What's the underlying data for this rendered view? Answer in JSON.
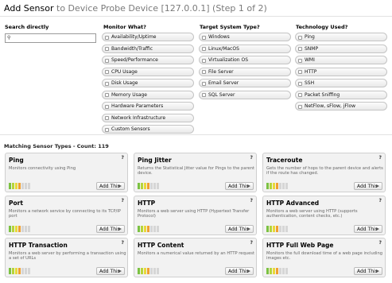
{
  "header": {
    "title": "Add Sensor",
    "subtitle": "to Device Probe Device [127.0.0.1] (Step 1 of 2)"
  },
  "search": {
    "heading": "Search directly",
    "value": "",
    "placeholder": ""
  },
  "monitor": {
    "heading": "Monitor What?",
    "items": [
      "Availability/Uptime",
      "Bandwidth/Traffic",
      "Speed/Performance",
      "CPU Usage",
      "Disk Usage",
      "Memory Usage",
      "Hardware Parameters",
      "Network Infrastructure",
      "Custom Sensors"
    ]
  },
  "target": {
    "heading": "Target System Type?",
    "items": [
      "Windows",
      "Linux/MacOS",
      "Virtualization OS",
      "File Server",
      "Email Server",
      "SQL Server"
    ]
  },
  "technology": {
    "heading": "Technology Used?",
    "items": [
      "Ping",
      "SNMP",
      "WMI",
      "HTTP",
      "SSH",
      "Packet Sniffing",
      "NetFlow, sFlow, jFlow"
    ]
  },
  "results": {
    "count_label": "Matching Sensor Types - Count: 119",
    "add_label": "Add This",
    "help_label": "?",
    "cards": [
      {
        "name": "Ping",
        "desc": "Monitors connectivity using Ping",
        "level": 4
      },
      {
        "name": "Ping Jitter",
        "desc": "Returns the Statistical Jitter value for Pings to the parent device.",
        "level": 4
      },
      {
        "name": "Traceroute",
        "desc": "Gets the number of hops to the parent device and alerts if the route has changed.",
        "level": 4
      },
      {
        "name": "Port",
        "desc": "Monitors a network service by connecting to its TCP/IP port",
        "level": 4
      },
      {
        "name": "HTTP",
        "desc": "Monitors a web server using HTTP (Hypertext Transfer Protocol)",
        "level": 4
      },
      {
        "name": "HTTP Advanced",
        "desc": "Monitors a web server using HTTP (supports authentication, content checks, etc.)",
        "level": 4
      },
      {
        "name": "HTTP Transaction",
        "desc": "Monitors a web server by performing a transaction using a set of URLs",
        "level": 4
      },
      {
        "name": "HTTP Content",
        "desc": "Monitors a numerical value returned by an HTTP request",
        "level": 4
      },
      {
        "name": "HTTP Full Web Page",
        "desc": "Monitors the full download time of a web page including images etc.",
        "level": 4
      }
    ]
  },
  "colors": {
    "card_bg": "#f2f2f2",
    "level_colors": [
      "#7cc242",
      "#b7d43a",
      "#e8d93a",
      "#f0a030",
      "#d6d6d6",
      "#d6d6d6",
      "#d6d6d6"
    ]
  }
}
